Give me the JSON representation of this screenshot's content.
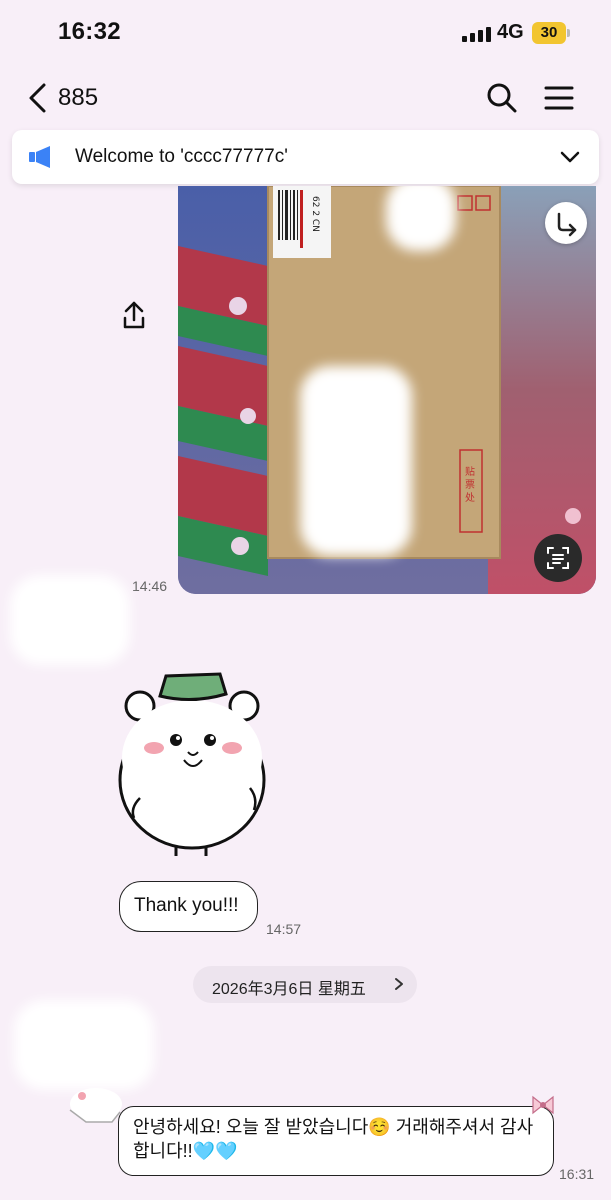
{
  "status_bar": {
    "time": "16:32",
    "network": "4G",
    "battery": "30"
  },
  "header": {
    "title": "885"
  },
  "announcement": {
    "text": "Welcome to 'cccc77777c'"
  },
  "messages": {
    "photo_time": "14:46",
    "thanks_text": "Thank you!!!",
    "thanks_time": "14:57",
    "date_divider": "2026年3月6日 星期五",
    "korean_text": "안녕하세요! 오늘 잘 받았습니다☺️ 거래해주셔서 감사합니다!!🩵🩵",
    "korean_time": "16:31"
  },
  "photo_content": {
    "label_code": "62 2 CN",
    "stamp_text": "贴 票 处"
  },
  "colors": {
    "background": "#f8eff8",
    "battery": "#f2c530",
    "megaphone": "#3b82f6",
    "bubble_border": "#222222"
  },
  "icons": [
    "back-icon",
    "search-icon",
    "menu-icon",
    "megaphone-icon",
    "chevron-down-icon",
    "share-icon",
    "forward-icon",
    "ocr-icon"
  ]
}
